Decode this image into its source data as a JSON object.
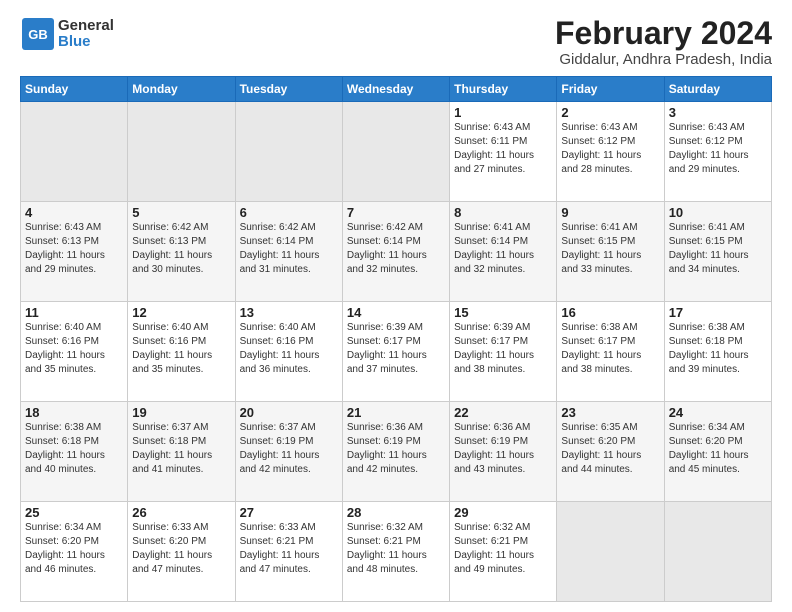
{
  "header": {
    "logo_line1": "General",
    "logo_line2": "Blue",
    "title": "February 2024",
    "subtitle": "Giddalur, Andhra Pradesh, India"
  },
  "days_of_week": [
    "Sunday",
    "Monday",
    "Tuesday",
    "Wednesday",
    "Thursday",
    "Friday",
    "Saturday"
  ],
  "weeks": [
    [
      {
        "day": "",
        "empty": true
      },
      {
        "day": "",
        "empty": true
      },
      {
        "day": "",
        "empty": true
      },
      {
        "day": "",
        "empty": true
      },
      {
        "day": "1",
        "sunrise": "6:43 AM",
        "sunset": "6:11 PM",
        "daylight": "11 hours and 27 minutes."
      },
      {
        "day": "2",
        "sunrise": "6:43 AM",
        "sunset": "6:12 PM",
        "daylight": "11 hours and 28 minutes."
      },
      {
        "day": "3",
        "sunrise": "6:43 AM",
        "sunset": "6:12 PM",
        "daylight": "11 hours and 29 minutes."
      }
    ],
    [
      {
        "day": "4",
        "sunrise": "6:43 AM",
        "sunset": "6:13 PM",
        "daylight": "11 hours and 29 minutes."
      },
      {
        "day": "5",
        "sunrise": "6:42 AM",
        "sunset": "6:13 PM",
        "daylight": "11 hours and 30 minutes."
      },
      {
        "day": "6",
        "sunrise": "6:42 AM",
        "sunset": "6:14 PM",
        "daylight": "11 hours and 31 minutes."
      },
      {
        "day": "7",
        "sunrise": "6:42 AM",
        "sunset": "6:14 PM",
        "daylight": "11 hours and 32 minutes."
      },
      {
        "day": "8",
        "sunrise": "6:41 AM",
        "sunset": "6:14 PM",
        "daylight": "11 hours and 32 minutes."
      },
      {
        "day": "9",
        "sunrise": "6:41 AM",
        "sunset": "6:15 PM",
        "daylight": "11 hours and 33 minutes."
      },
      {
        "day": "10",
        "sunrise": "6:41 AM",
        "sunset": "6:15 PM",
        "daylight": "11 hours and 34 minutes."
      }
    ],
    [
      {
        "day": "11",
        "sunrise": "6:40 AM",
        "sunset": "6:16 PM",
        "daylight": "11 hours and 35 minutes."
      },
      {
        "day": "12",
        "sunrise": "6:40 AM",
        "sunset": "6:16 PM",
        "daylight": "11 hours and 35 minutes."
      },
      {
        "day": "13",
        "sunrise": "6:40 AM",
        "sunset": "6:16 PM",
        "daylight": "11 hours and 36 minutes."
      },
      {
        "day": "14",
        "sunrise": "6:39 AM",
        "sunset": "6:17 PM",
        "daylight": "11 hours and 37 minutes."
      },
      {
        "day": "15",
        "sunrise": "6:39 AM",
        "sunset": "6:17 PM",
        "daylight": "11 hours and 38 minutes."
      },
      {
        "day": "16",
        "sunrise": "6:38 AM",
        "sunset": "6:17 PM",
        "daylight": "11 hours and 38 minutes."
      },
      {
        "day": "17",
        "sunrise": "6:38 AM",
        "sunset": "6:18 PM",
        "daylight": "11 hours and 39 minutes."
      }
    ],
    [
      {
        "day": "18",
        "sunrise": "6:38 AM",
        "sunset": "6:18 PM",
        "daylight": "11 hours and 40 minutes."
      },
      {
        "day": "19",
        "sunrise": "6:37 AM",
        "sunset": "6:18 PM",
        "daylight": "11 hours and 41 minutes."
      },
      {
        "day": "20",
        "sunrise": "6:37 AM",
        "sunset": "6:19 PM",
        "daylight": "11 hours and 42 minutes."
      },
      {
        "day": "21",
        "sunrise": "6:36 AM",
        "sunset": "6:19 PM",
        "daylight": "11 hours and 42 minutes."
      },
      {
        "day": "22",
        "sunrise": "6:36 AM",
        "sunset": "6:19 PM",
        "daylight": "11 hours and 43 minutes."
      },
      {
        "day": "23",
        "sunrise": "6:35 AM",
        "sunset": "6:20 PM",
        "daylight": "11 hours and 44 minutes."
      },
      {
        "day": "24",
        "sunrise": "6:34 AM",
        "sunset": "6:20 PM",
        "daylight": "11 hours and 45 minutes."
      }
    ],
    [
      {
        "day": "25",
        "sunrise": "6:34 AM",
        "sunset": "6:20 PM",
        "daylight": "11 hours and 46 minutes."
      },
      {
        "day": "26",
        "sunrise": "6:33 AM",
        "sunset": "6:20 PM",
        "daylight": "11 hours and 47 minutes."
      },
      {
        "day": "27",
        "sunrise": "6:33 AM",
        "sunset": "6:21 PM",
        "daylight": "11 hours and 47 minutes."
      },
      {
        "day": "28",
        "sunrise": "6:32 AM",
        "sunset": "6:21 PM",
        "daylight": "11 hours and 48 minutes."
      },
      {
        "day": "29",
        "sunrise": "6:32 AM",
        "sunset": "6:21 PM",
        "daylight": "11 hours and 49 minutes."
      },
      {
        "day": "",
        "empty": true
      },
      {
        "day": "",
        "empty": true
      }
    ]
  ]
}
